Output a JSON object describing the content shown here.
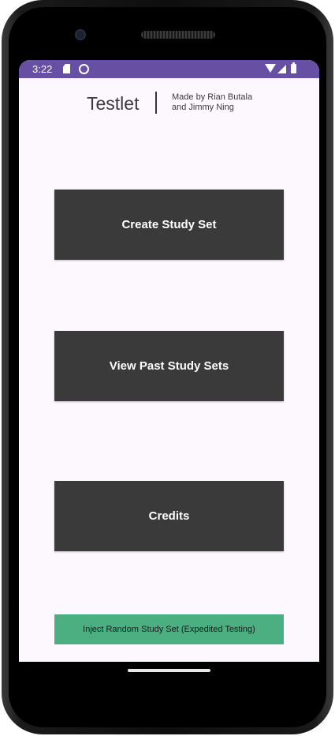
{
  "status_bar": {
    "time": "3:22",
    "icons": [
      "sd-card-icon",
      "face-icon",
      "wifi-icon",
      "signal-icon",
      "battery-icon"
    ],
    "color": "#6750a4"
  },
  "header": {
    "title": "Testlet",
    "subtitle": "Made by Rian Butala\nand Jimmy Ning"
  },
  "buttons": {
    "create": "Create Study Set",
    "view": "View Past Study Sets",
    "credits": "Credits",
    "inject": "Inject Random Study Set (Expedited Testing)"
  },
  "colors": {
    "screen_bg": "#fdf7fe",
    "button_bg": "#3a3a3a",
    "inject_bg": "#4caf82"
  }
}
